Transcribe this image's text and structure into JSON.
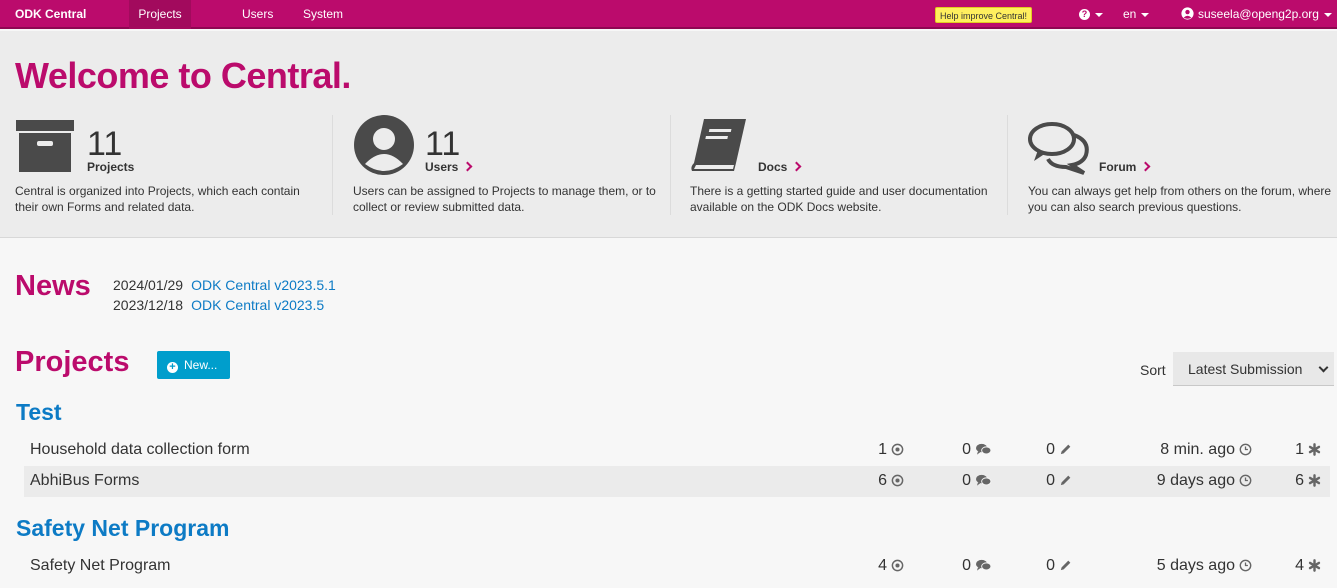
{
  "nav": {
    "brand": "ODK Central",
    "projects": "Projects",
    "users": "Users",
    "system": "System",
    "improve": "Help improve Central!",
    "help_icon": "question-circle-icon",
    "lang": "en",
    "user_email": "suseela@openg2p.org"
  },
  "welcome": {
    "title": "Welcome to Central.",
    "cards": [
      {
        "icon": "archive-icon",
        "count": "11",
        "label": "Projects",
        "desc": "Central is organized into Projects, which each contain their own Forms and related data."
      },
      {
        "icon": "user-icon",
        "count": "11",
        "label": "Users",
        "desc": "Users can be assigned to Projects to manage them, or to collect or review submitted data."
      },
      {
        "icon": "book-icon",
        "count": "",
        "label": "Docs",
        "desc": "There is a getting started guide and user documentation available on the ODK Docs website."
      },
      {
        "icon": "comments-icon",
        "count": "",
        "label": "Forum",
        "desc": "You can always get help from others on the forum, where you can also search previous questions."
      }
    ]
  },
  "news": {
    "title": "News",
    "items": [
      {
        "date": "2024/01/29",
        "link": "ODK Central v2023.5.1"
      },
      {
        "date": "2023/12/18",
        "link": "ODK Central v2023.5"
      }
    ]
  },
  "projects": {
    "title": "Projects",
    "new_label": "New...",
    "sort_label": "Sort",
    "sort_value": "Latest Submission",
    "groups": [
      {
        "name": "Test",
        "forms": [
          {
            "name": "Household data collection form",
            "submissions": "1",
            "comments": "0",
            "edits": "0",
            "last": "8 min. ago",
            "fields": "1"
          },
          {
            "name": "AbhiBus Forms",
            "submissions": "6",
            "comments": "0",
            "edits": "0",
            "last": "9 days ago",
            "fields": "6"
          }
        ]
      },
      {
        "name": "Safety Net Program",
        "forms": [
          {
            "name": "Safety Net Program",
            "submissions": "4",
            "comments": "0",
            "edits": "0",
            "last": "5 days ago",
            "fields": "4"
          }
        ]
      }
    ]
  },
  "colors": {
    "brand": "#bb0b6c",
    "link": "#0d7bc5",
    "button": "#009ecc"
  }
}
